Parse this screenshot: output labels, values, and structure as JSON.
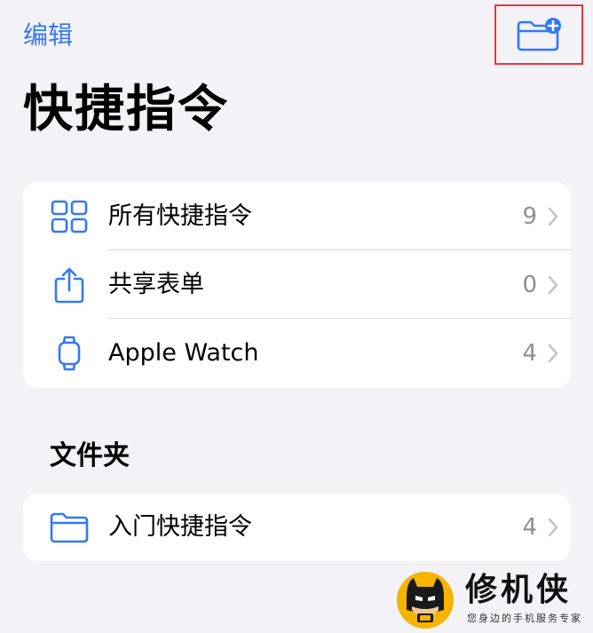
{
  "nav": {
    "edit_label": "编辑"
  },
  "page": {
    "title": "快捷指令"
  },
  "library": {
    "items": [
      {
        "label": "所有快捷指令",
        "count": "9",
        "icon": "grid-icon"
      },
      {
        "label": "共享表单",
        "count": "0",
        "icon": "share-icon"
      },
      {
        "label": "Apple Watch",
        "count": "4",
        "icon": "watch-icon"
      }
    ]
  },
  "folders": {
    "section_title": "文件夹",
    "items": [
      {
        "label": "入门快捷指令",
        "count": "4",
        "icon": "folder-icon"
      }
    ]
  },
  "watermark": {
    "name": "修机侠",
    "slogan": "您身边的手机服务专家"
  },
  "colors": {
    "accent": "#3478f6",
    "background": "#f2f2f7",
    "highlight_box": "#e8363c",
    "secondary_text": "#8e8e93"
  }
}
